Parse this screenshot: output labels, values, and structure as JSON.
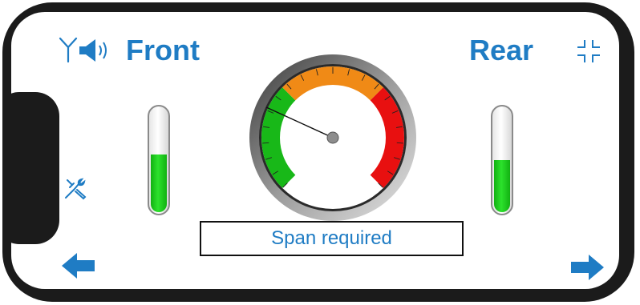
{
  "header": {
    "front_label": "Front",
    "rear_label": "Rear"
  },
  "status": {
    "message": "Span required"
  },
  "gauges": {
    "front_level": 0.55,
    "rear_level": 0.5
  },
  "dial": {
    "needle_zone": "green"
  },
  "icons": {
    "antenna": "antenna-icon",
    "speaker": "speaker-icon",
    "collapse": "collapse-icon",
    "tools": "tools-icon",
    "back": "arrow-left-icon",
    "forward": "arrow-right-icon"
  },
  "colors": {
    "accent": "#1f7cc4",
    "green_zone": "#18b818",
    "orange_zone": "#f08a16",
    "red_zone": "#e81010"
  }
}
